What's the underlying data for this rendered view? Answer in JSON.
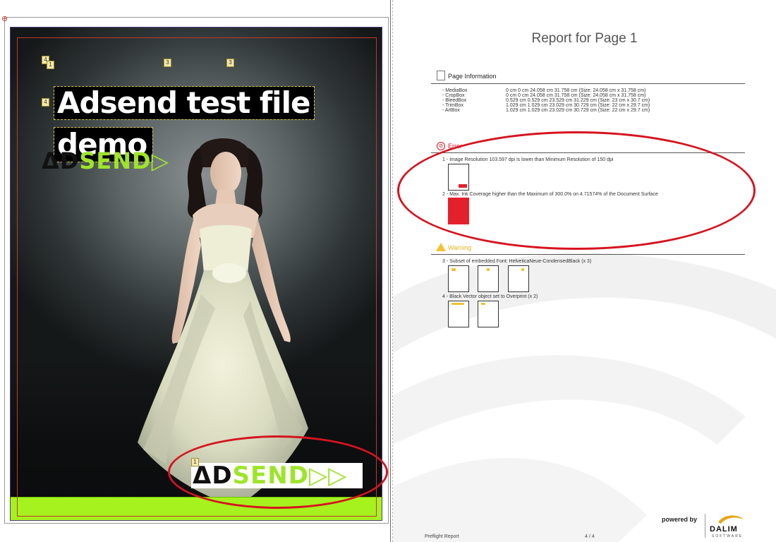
{
  "left_page": {
    "crop_mark": "⊕",
    "title_line1": "Adsend test file",
    "title_line2": "demo",
    "badges": [
      "4",
      "1",
      "3",
      "3",
      "4",
      "1"
    ],
    "logo_top": {
      "ad": "ΔD",
      "send": "SEND▷"
    },
    "logo_bottom": {
      "ad": "ΔD",
      "send": "SEND▷▷"
    },
    "colors": {
      "trim": "#a6f21f",
      "logo_green": "#9ee42a",
      "annotation_red": "#d5141f"
    }
  },
  "report": {
    "title": "Report for Page 1",
    "page_info_title": "Page Information",
    "boxes": [
      {
        "name": "- MediaBox",
        "value": "0 cm 0 cm 24.058 cm 31.758 cm  (Size: 24.058 cm x 31.758 cm)"
      },
      {
        "name": "- CropBox",
        "value": "0 cm 0 cm 24.058 cm 31.758 cm  (Size: 24.058 cm x 31.758 cm)"
      },
      {
        "name": "- BleedBox",
        "value": "0.529 cm 0.529 cm 23.529 cm 31.229 cm  (Size: 23 cm x 30.7 cm)"
      },
      {
        "name": "- TrimBox",
        "value": "1.029 cm 1.029 cm 23.029 cm 30.729 cm  (Size: 22 cm x 29.7 cm)"
      },
      {
        "name": "- ArtBox",
        "value": "1.029 cm 1.029 cm 23.029 cm 30.729 cm  (Size: 22 cm x 29.7 cm)"
      }
    ],
    "error_title": "Error",
    "errors": [
      "1 - Image Resolution 103.597 dpi is lower than Minimum Resolution of 150 dpi",
      "2 - Max. Ink Coverage higher than the Maximum of 300.0% on 4.71574% of the Document Surface"
    ],
    "warning_title": "Warning",
    "warnings": [
      "3 - Subset of embedded Font: HelveticaNeue-CondensedBlack  (x 3)",
      "4 - Black Vector object set to Overprint (x 2)"
    ],
    "powered_by": "powered by",
    "brand": "DALIM",
    "brand_sub": "SOFTWARE",
    "footer_left": "Preflight Report",
    "footer_mid": "4 / 4"
  }
}
